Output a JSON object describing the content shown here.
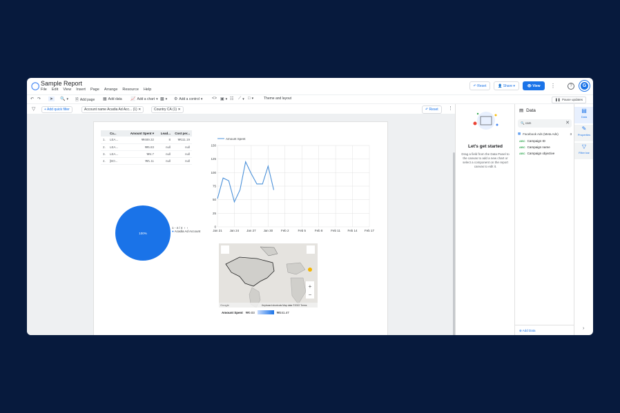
{
  "app": {
    "title": "Sample Report"
  },
  "menu": [
    "File",
    "Edit",
    "View",
    "Insert",
    "Page",
    "Arrange",
    "Resource",
    "Help"
  ],
  "header": {
    "reset": "Reset",
    "share": "Share",
    "view": "View"
  },
  "toolbar": {
    "add_page": "Add page",
    "add_data": "Add data",
    "add_chart": "Add a chart",
    "add_control": "Add a control",
    "theme": "Theme and layout",
    "pause": "Pause updates"
  },
  "filterbar": {
    "add_filter": "+ Add quick filter",
    "chip1": "Account name  Acadia Ad Acc...  (1)",
    "chip2": "Country  CA (1)",
    "reset": "Reset"
  },
  "table": {
    "headers": [
      "Ca...",
      "Amount Spent ▾",
      "Lead...",
      "Cost per..."
    ],
    "rows": [
      [
        "1.",
        "LEA...",
        "₩489.32",
        "8",
        "₩111.19"
      ],
      [
        "2.",
        "LEA...",
        "₩5.83",
        "null",
        "null"
      ],
      [
        "3.",
        "LEA...",
        "₩4.7",
        "null",
        "null"
      ],
      [
        "4.",
        "[BO...",
        "₩1.11",
        "null",
        "null"
      ]
    ]
  },
  "pie": {
    "center_label": "100%",
    "pager": "1 - 4 / 4",
    "legend_item": "Acadia Ad Account",
    "color": "#1a73e8"
  },
  "chart_data": {
    "type": "line",
    "legend": "Amount Spent",
    "x_ticks": [
      "Jan 21",
      "Jan 24",
      "Jan 27",
      "Jan 30",
      "Feb 2",
      "Feb 5",
      "Feb 8",
      "Feb 11",
      "Feb 14",
      "Feb 17"
    ],
    "y_ticks": [
      "0",
      "25",
      "50",
      "75",
      "100",
      "125",
      "150"
    ],
    "ylim": [
      0,
      150
    ],
    "x": [
      0,
      1,
      2,
      3,
      4,
      5,
      6,
      7,
      8,
      9,
      10,
      11
    ],
    "values": [
      52,
      90,
      85,
      46,
      68,
      120,
      98,
      79,
      79,
      112,
      68
    ],
    "color": "#4a90d9"
  },
  "map": {
    "attrib": "Keyboard shortcuts   Map data ©2022   Terms",
    "google": "Google",
    "legend_label": "Amount Spent",
    "min": "₩0.03",
    "max": "₩241.47"
  },
  "right_panel": {
    "title": "Let's get started",
    "text": "Drag a field from the Data Panel to the canvas to add a new chart or select a component on the report canvas to edit it."
  },
  "data_panel": {
    "title": "Data",
    "search": "cam",
    "source": "Facebook Ads (Meta Ads)",
    "source_count": "3",
    "fields": [
      "Campaign ID",
      "Campaign name",
      "Campaign objective"
    ],
    "add_data": "Add Data"
  },
  "side_tabs": [
    "Data",
    "Properties",
    "Filter bar"
  ]
}
